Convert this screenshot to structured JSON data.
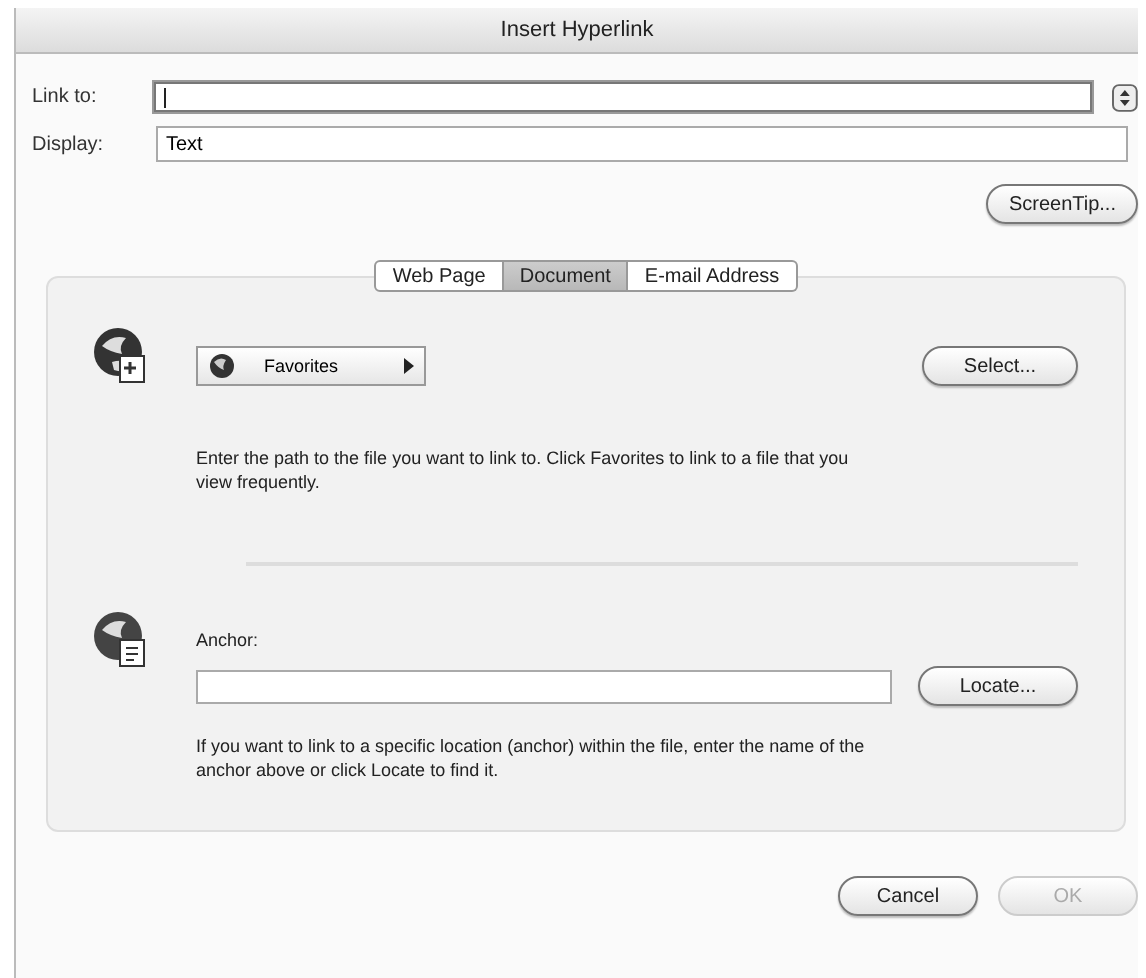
{
  "window": {
    "title": "Insert Hyperlink"
  },
  "link_to": {
    "label": "Link to:"
  },
  "display": {
    "label": "Display:",
    "value": "Text"
  },
  "screentip_button": "ScreenTip...",
  "tabs": [
    {
      "label": "Web Page",
      "selected": false
    },
    {
      "label": "Document",
      "selected": true
    },
    {
      "label": "E-mail Address",
      "selected": false
    }
  ],
  "document": {
    "favorites": "Favorites",
    "select_button": "Select...",
    "hint": "Enter the path to the file you want to link to. Click Favorites to link to a file that you view frequently.",
    "anchor_label": "Anchor:",
    "locate_button": "Locate...",
    "anchor_hint": "If you want to link to a specific location (anchor) within the file, enter the name of the anchor above or click Locate to find it."
  },
  "buttons": [
    {
      "label": "Cancel",
      "disabled": false
    },
    {
      "label": "OK",
      "disabled": true
    }
  ]
}
